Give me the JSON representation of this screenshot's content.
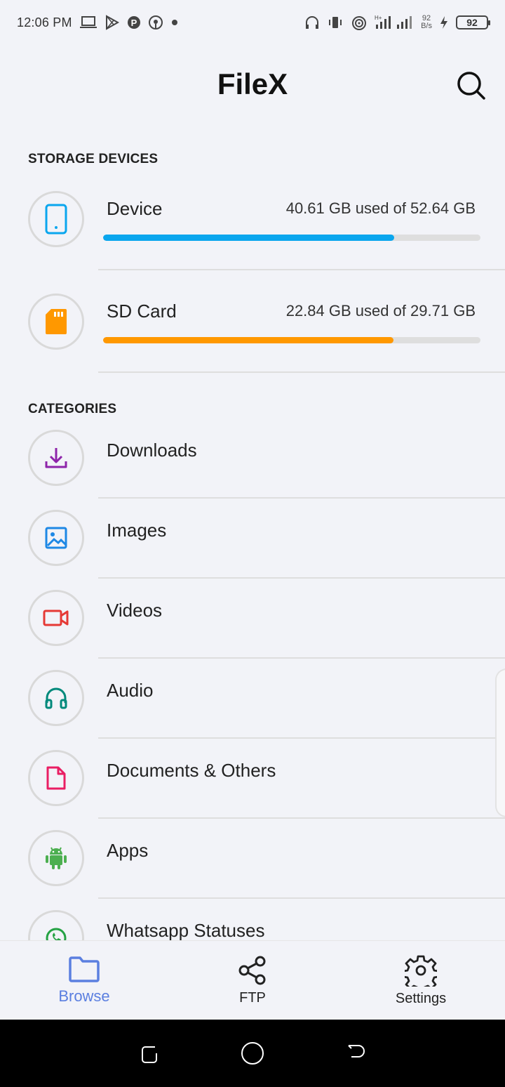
{
  "status_bar": {
    "time": "12:06 PM",
    "speed_value": "92",
    "speed_unit": "B/s",
    "battery": "92"
  },
  "header": {
    "title": "FileX"
  },
  "storage_section": {
    "label": "STORAGE DEVICES",
    "devices": [
      {
        "name": "Device",
        "usage": "40.61 GB used of 52.64 GB",
        "used_gb": 40.61,
        "total_gb": 52.64,
        "color": "#0aa6ee",
        "icon": "phone-icon"
      },
      {
        "name": "SD Card",
        "usage": "22.84 GB used of 29.71 GB",
        "used_gb": 22.84,
        "total_gb": 29.71,
        "color": "#ff9800",
        "icon": "sd-card-icon"
      }
    ]
  },
  "categories_section": {
    "label": "CATEGORIES",
    "items": [
      {
        "label": "Downloads",
        "icon": "download-icon",
        "color": "#8e24aa"
      },
      {
        "label": "Images",
        "icon": "image-icon",
        "color": "#1e88e5"
      },
      {
        "label": "Videos",
        "icon": "video-icon",
        "color": "#e53935"
      },
      {
        "label": "Audio",
        "icon": "headphones-icon",
        "color": "#00897b"
      },
      {
        "label": "Documents & Others",
        "icon": "document-icon",
        "color": "#e91e63"
      },
      {
        "label": "Apps",
        "icon": "android-icon",
        "color": "#4caf50"
      },
      {
        "label": "Whatsapp Statuses",
        "icon": "whatsapp-icon",
        "color": "#25a244"
      }
    ]
  },
  "bottom_nav": {
    "items": [
      {
        "label": "Browse",
        "icon": "folder-icon",
        "active": true
      },
      {
        "label": "FTP",
        "icon": "share-icon",
        "active": false
      },
      {
        "label": "Settings",
        "icon": "gear-icon",
        "active": false
      }
    ]
  },
  "colors": {
    "accent": "#5b7fe0",
    "background": "#f2f3f8"
  }
}
